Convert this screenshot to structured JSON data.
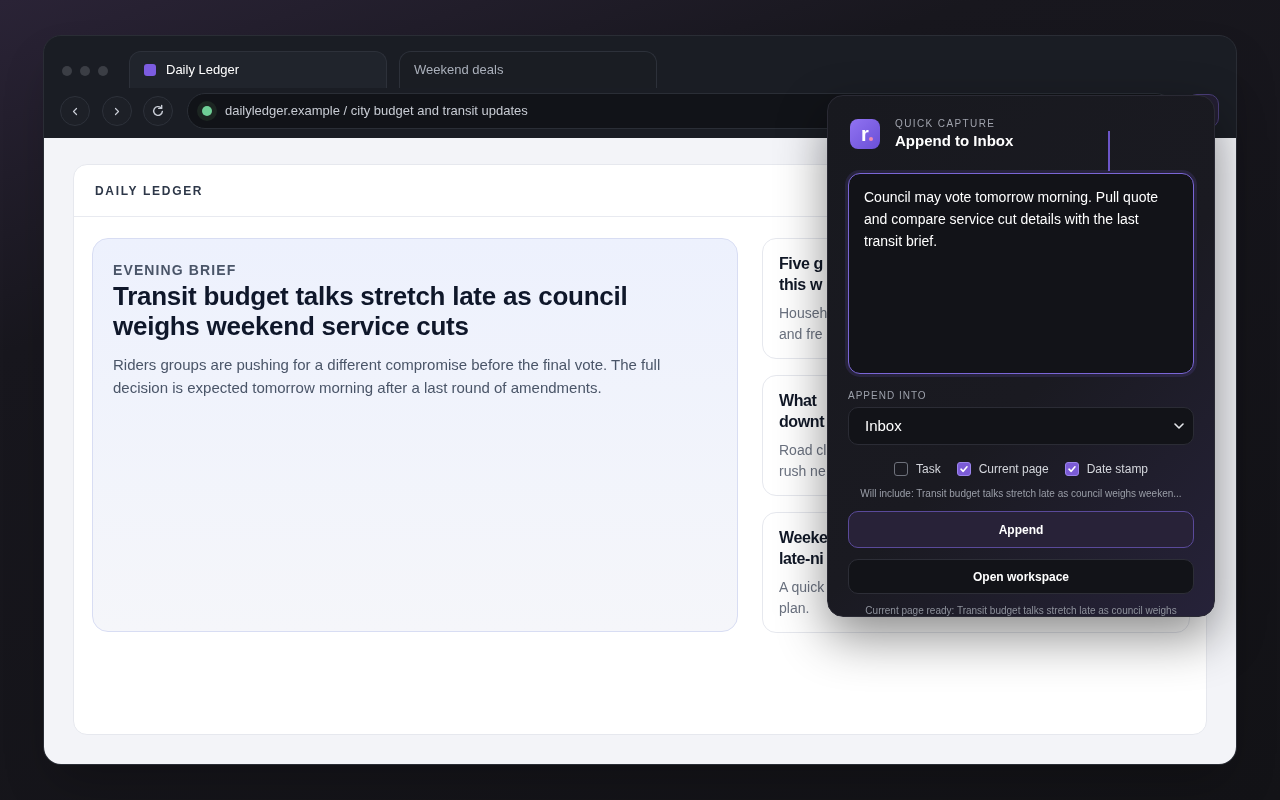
{
  "tabs": [
    {
      "label": "Daily Ledger",
      "selected": true,
      "favicon": true
    },
    {
      "label": "Weekend deals",
      "selected": false,
      "favicon": false
    }
  ],
  "address_bar": {
    "url": "dailyledger.example / city budget and transit updates"
  },
  "page": {
    "brand": "DAILY LEDGER",
    "feature": {
      "eyebrow": "EVENING BRIEF",
      "title": "Transit budget talks stretch late as council weighs weekend service cuts",
      "summary": "Riders groups are pushing for a different compromise before the final vote. The full decision is expected tomorrow morning after a last round of amendments."
    },
    "cards": [
      {
        "title_lines": [
          "Five g",
          "this w"
        ],
        "body_lines": [
          "Househ",
          "and fre"
        ]
      },
      {
        "title_lines": [
          "What",
          "downt"
        ],
        "body_lines": [
          "Road cl",
          "rush ne"
        ]
      },
      {
        "title_lines": [
          "Weeke",
          "late-ni"
        ],
        "body_lines": [
          "A quick",
          "plan."
        ]
      }
    ]
  },
  "popup": {
    "logo": "r",
    "eyebrow": "QUICK CAPTURE",
    "title": "Append to Inbox",
    "note": "Council may vote tomorrow morning. Pull quote and compare service cut details with the last transit brief.",
    "target_label": "APPEND INTO",
    "target": "Inbox",
    "options": [
      {
        "label": "Task",
        "checked": false
      },
      {
        "label": "Current page",
        "checked": true
      },
      {
        "label": "Date stamp",
        "checked": true
      }
    ],
    "preview": "Will include: Transit budget talks stretch late as council weighs weeken...",
    "buttons": [
      {
        "label": "Append",
        "kind": "primary"
      },
      {
        "label": "Open workspace",
        "kind": "secondary"
      }
    ],
    "status": "Current page ready: Transit budget talks stretch late as council weighs"
  }
}
